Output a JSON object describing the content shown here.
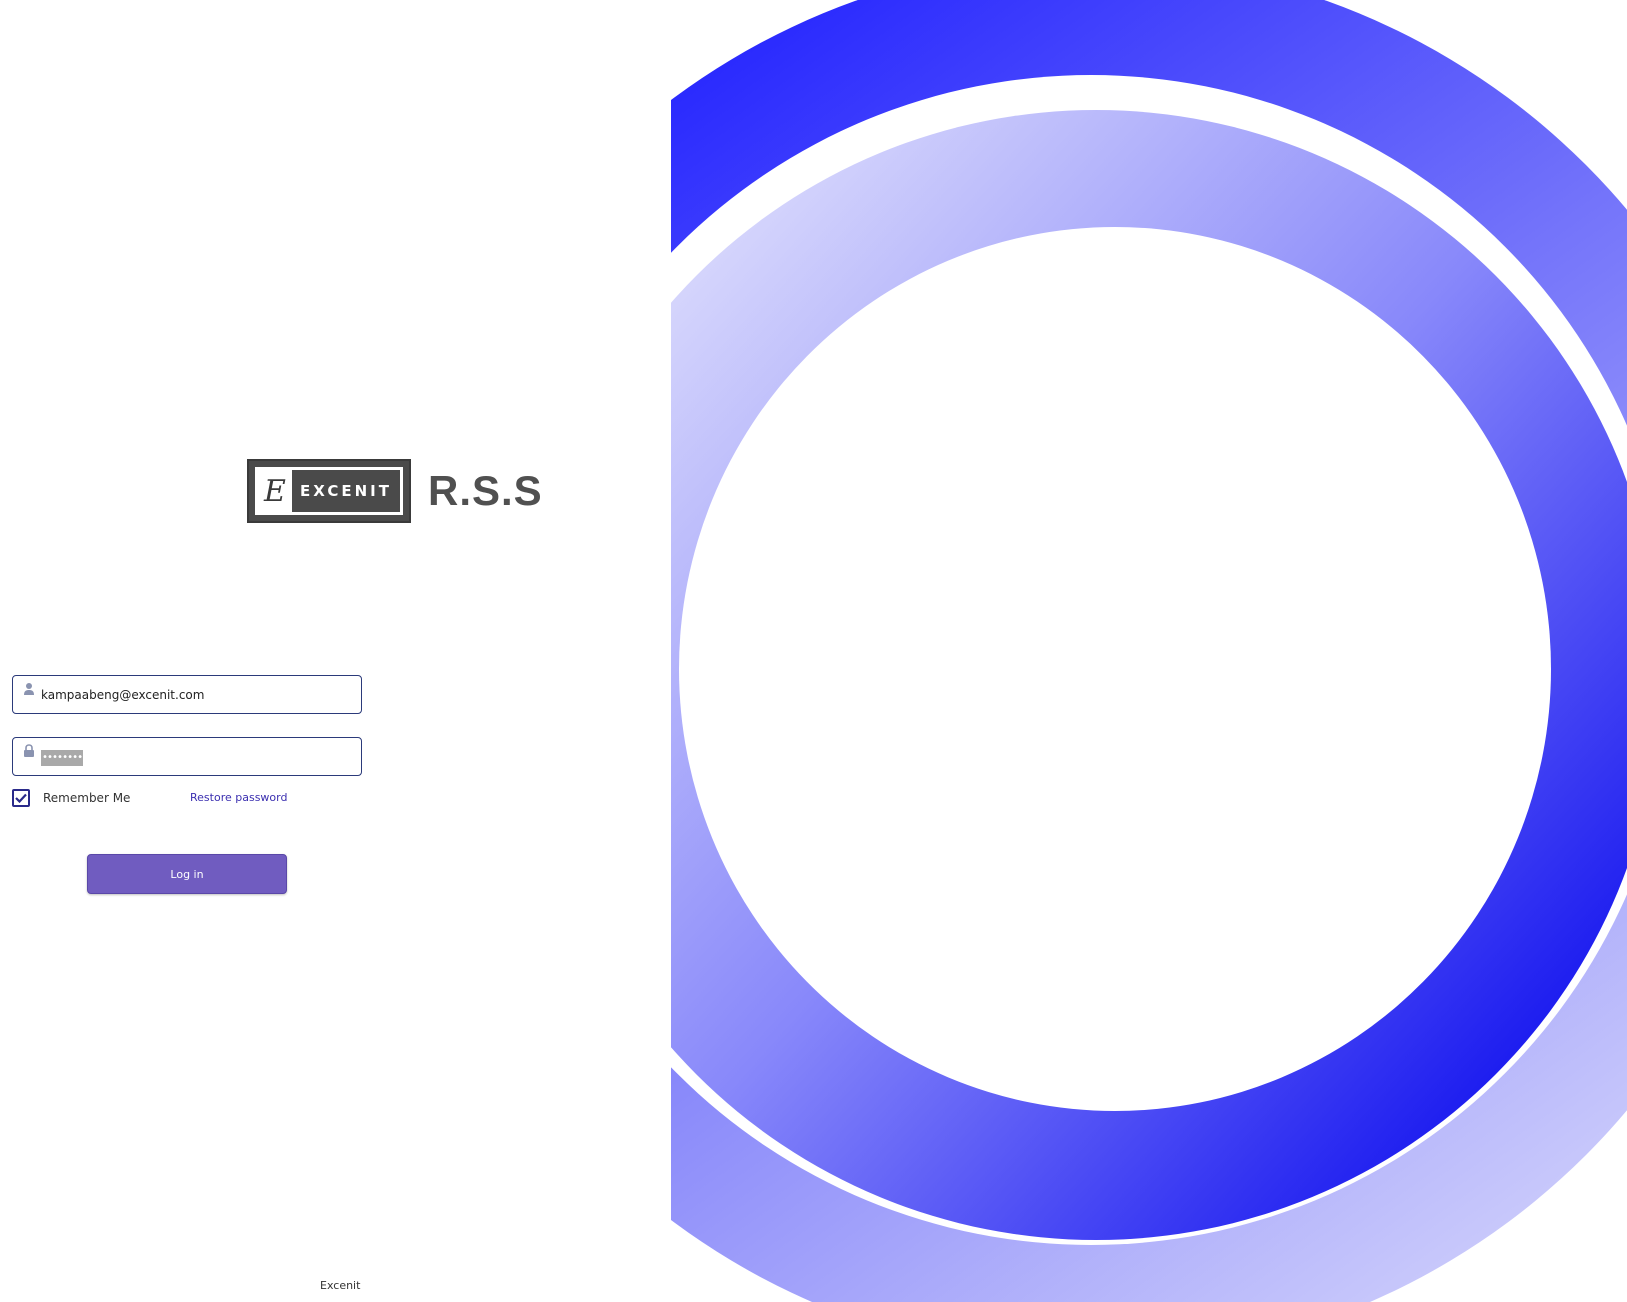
{
  "logo": {
    "letter": "E",
    "brand": "EXCENIT",
    "product": "R.S.S"
  },
  "login": {
    "email_value": "kampaabeng@excenit.com",
    "password_mask": "••••••••",
    "remember_label": "Remember Me",
    "remember_checked": true,
    "restore_label": "Restore password",
    "submit_label": "Log in"
  },
  "footer": {
    "text": "Excenit"
  },
  "icons": {
    "email": "user-icon",
    "password": "lock-icon",
    "remember": "checkmark-icon"
  },
  "colors": {
    "primary": "#705cc0",
    "link": "#3b2fb0",
    "field_border": "#2b3a7a",
    "art_deep": "#0a0af0",
    "art_light": "#d6d6fa"
  }
}
